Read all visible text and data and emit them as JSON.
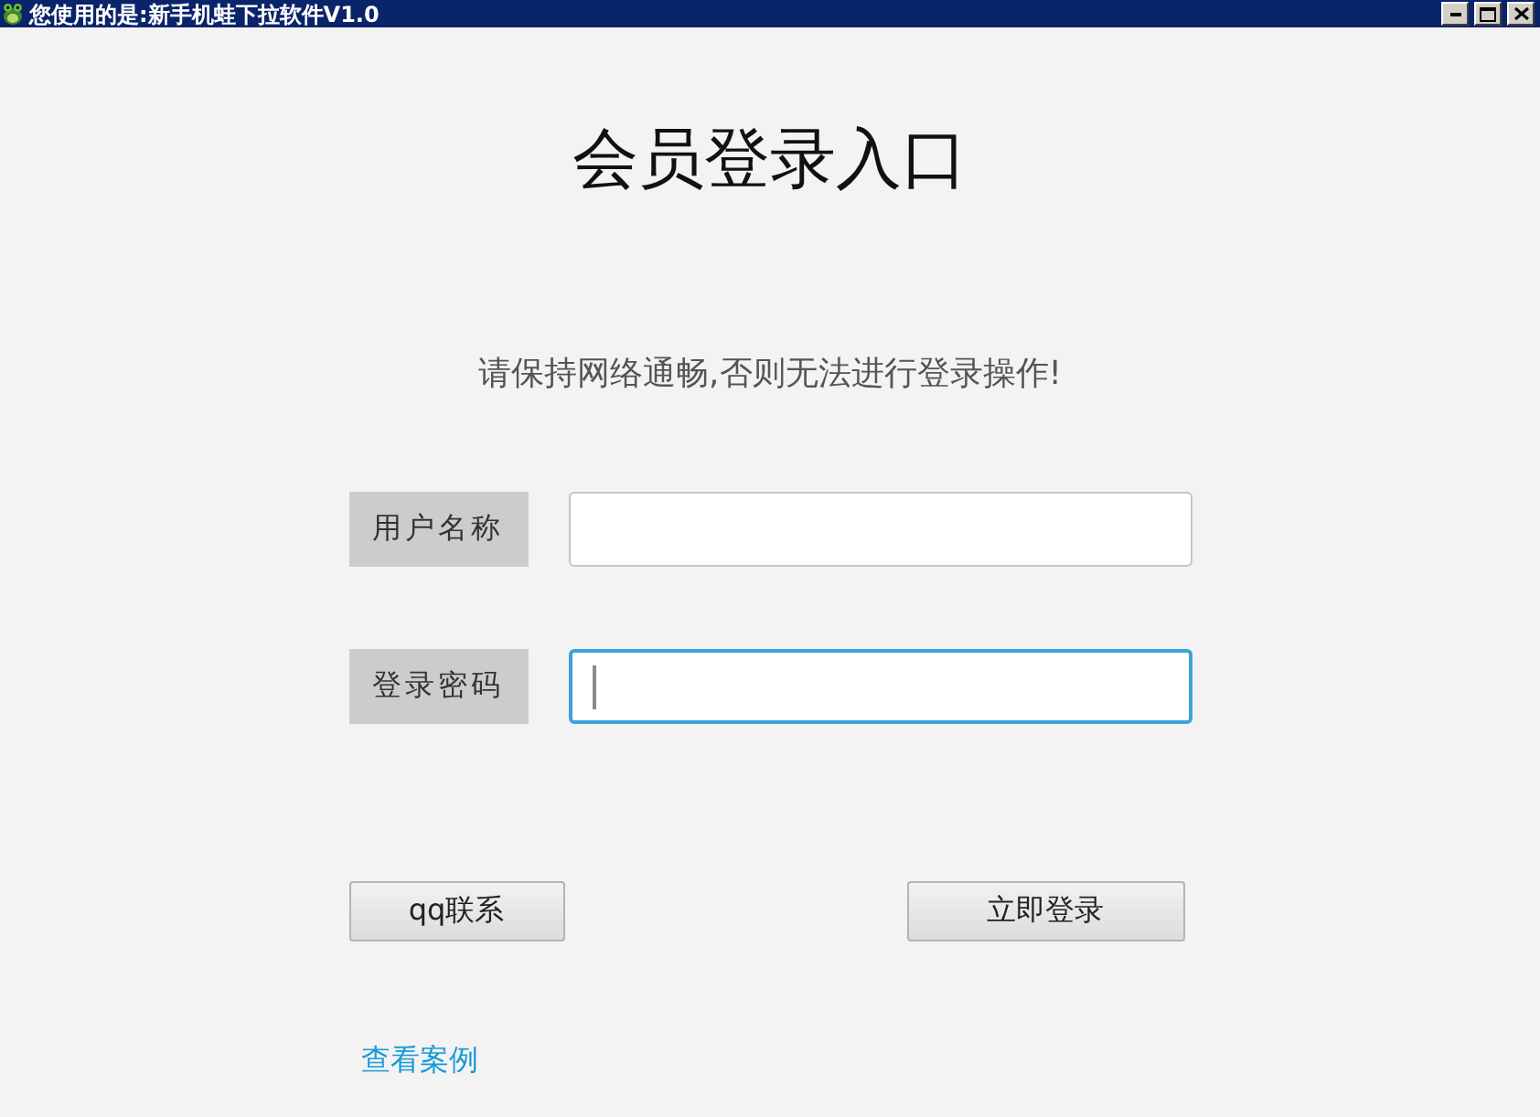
{
  "window": {
    "title": "您使用的是:新手机蛙下拉软件V1.0"
  },
  "heading": "会员登录入口",
  "notice": "请保持网络通畅,否则无法进行登录操作!",
  "fields": [
    {
      "label": "用户名称",
      "focused": false
    },
    {
      "label": "登录密码",
      "focused": true
    }
  ],
  "buttons": [
    "qq联系",
    "立即登录"
  ],
  "link": "查看案例"
}
